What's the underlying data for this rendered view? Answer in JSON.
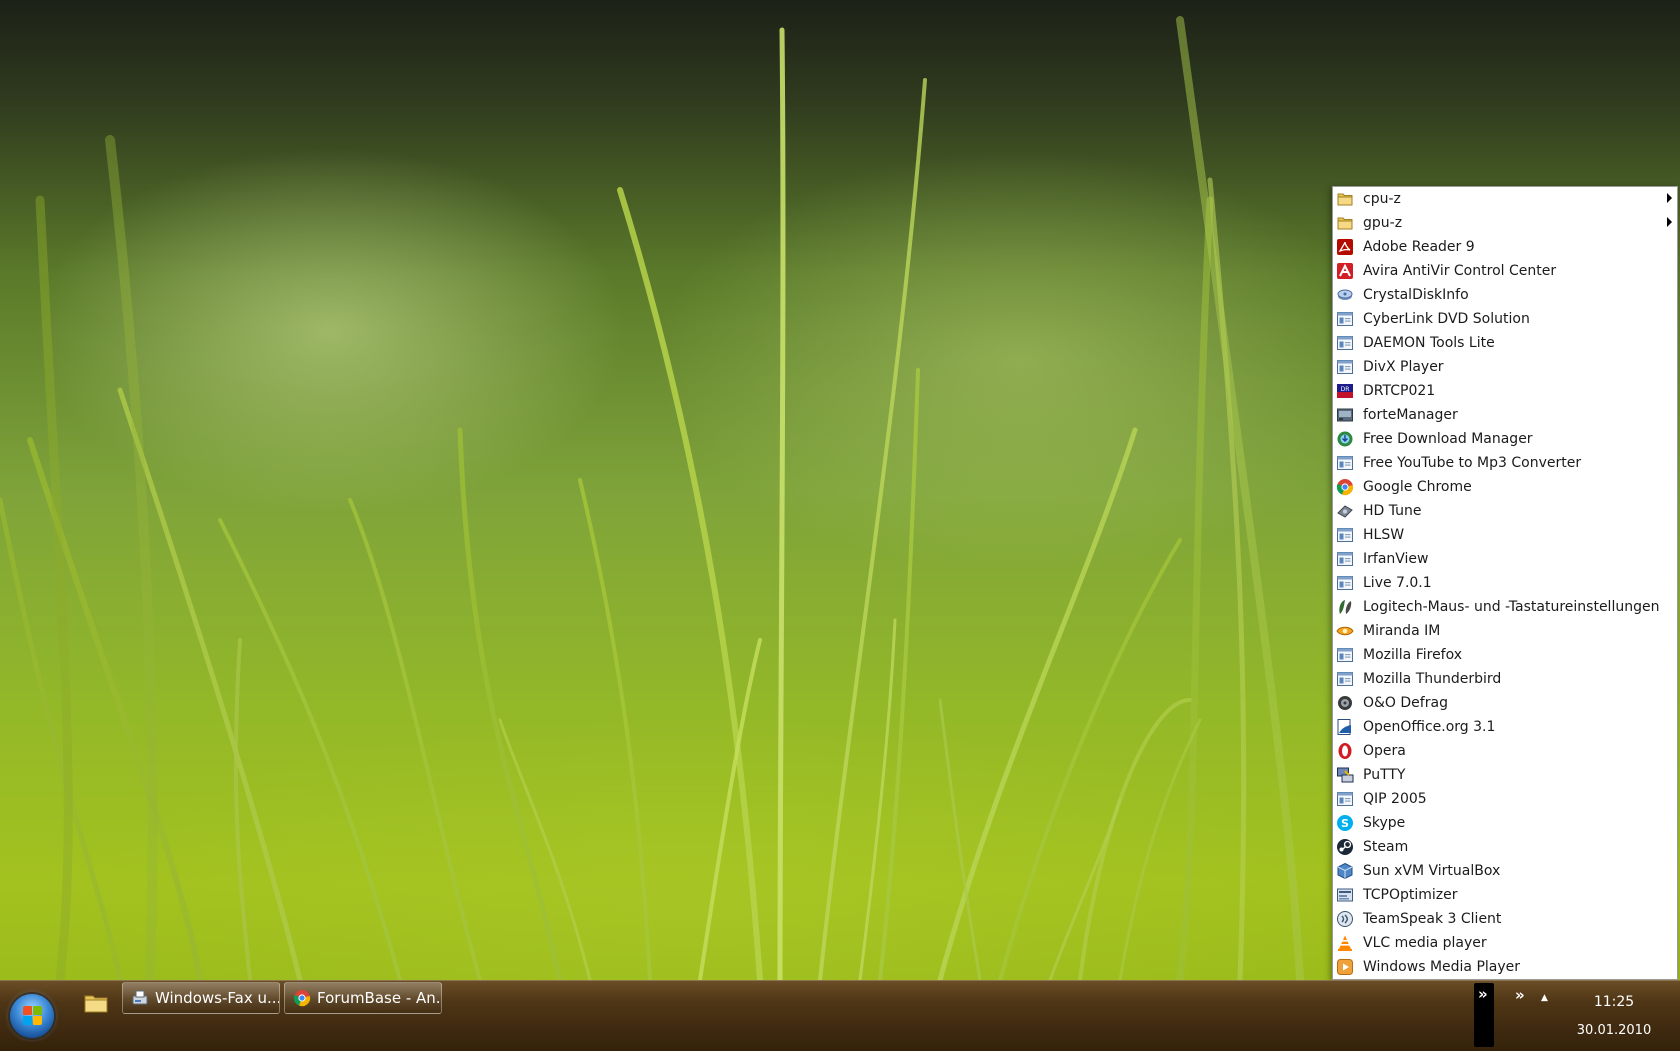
{
  "menu": {
    "items": [
      {
        "label": "cpu-z",
        "icon": "folder-icon",
        "submenu": true
      },
      {
        "label": "gpu-z",
        "icon": "folder-icon",
        "submenu": true
      },
      {
        "label": "Adobe Reader 9",
        "icon": "adobe-reader-icon"
      },
      {
        "label": "Avira AntiVir Control Center",
        "icon": "avira-icon"
      },
      {
        "label": "CrystalDiskInfo",
        "icon": "crystaldiskinfo-icon"
      },
      {
        "label": "CyberLink DVD Solution",
        "icon": "program-group-icon"
      },
      {
        "label": "DAEMON Tools Lite",
        "icon": "program-group-icon"
      },
      {
        "label": "DivX Player",
        "icon": "program-group-icon"
      },
      {
        "label": "DRTCP021",
        "icon": "drtcp-icon"
      },
      {
        "label": "forteManager",
        "icon": "fortemanager-icon"
      },
      {
        "label": "Free Download Manager",
        "icon": "fdm-icon"
      },
      {
        "label": "Free YouTube to Mp3 Converter",
        "icon": "program-group-icon"
      },
      {
        "label": "Google Chrome",
        "icon": "chrome-icon"
      },
      {
        "label": "HD Tune",
        "icon": "hdtune-icon"
      },
      {
        "label": "HLSW",
        "icon": "program-group-icon"
      },
      {
        "label": "IrfanView",
        "icon": "program-group-icon"
      },
      {
        "label": "Live 7.0.1",
        "icon": "program-group-icon"
      },
      {
        "label": "Logitech-Maus- und -Tastatureinstellungen",
        "icon": "logitech-icon"
      },
      {
        "label": "Miranda IM",
        "icon": "miranda-icon"
      },
      {
        "label": "Mozilla Firefox",
        "icon": "program-group-icon"
      },
      {
        "label": "Mozilla Thunderbird",
        "icon": "program-group-icon"
      },
      {
        "label": "O&O Defrag",
        "icon": "oo-defrag-icon"
      },
      {
        "label": "OpenOffice.org 3.1",
        "icon": "openoffice-icon"
      },
      {
        "label": "Opera",
        "icon": "opera-icon"
      },
      {
        "label": "PuTTY",
        "icon": "putty-icon"
      },
      {
        "label": "QIP 2005",
        "icon": "program-group-icon"
      },
      {
        "label": "Skype",
        "icon": "skype-icon"
      },
      {
        "label": "Steam",
        "icon": "steam-icon"
      },
      {
        "label": "Sun xVM VirtualBox",
        "icon": "virtualbox-icon"
      },
      {
        "label": "TCPOptimizer",
        "icon": "tcpoptimizer-icon"
      },
      {
        "label": "TeamSpeak 3 Client",
        "icon": "teamspeak-icon"
      },
      {
        "label": "VLC media player",
        "icon": "vlc-icon"
      },
      {
        "label": "Windows Media Player",
        "icon": "windows-media-player-icon"
      }
    ]
  },
  "taskbar": {
    "start_icon": "windows-start-orb",
    "pinned": [
      {
        "icon": "windows-explorer-icon"
      }
    ],
    "buttons": [
      {
        "label": "Windows-Fax u...",
        "icon": "fax-icon"
      },
      {
        "label": "ForumBase - An...",
        "icon": "chrome-icon"
      }
    ],
    "toolbar_chevron": "»",
    "overflow_chevron": "»",
    "tray_up_arrow": "▲",
    "clock": {
      "time": "11:25",
      "date": "30.01.2010"
    }
  },
  "colors": {
    "taskbar": "#4e3515",
    "menu_bg": "#ffffff",
    "menu_text": "#1b1b1b"
  }
}
